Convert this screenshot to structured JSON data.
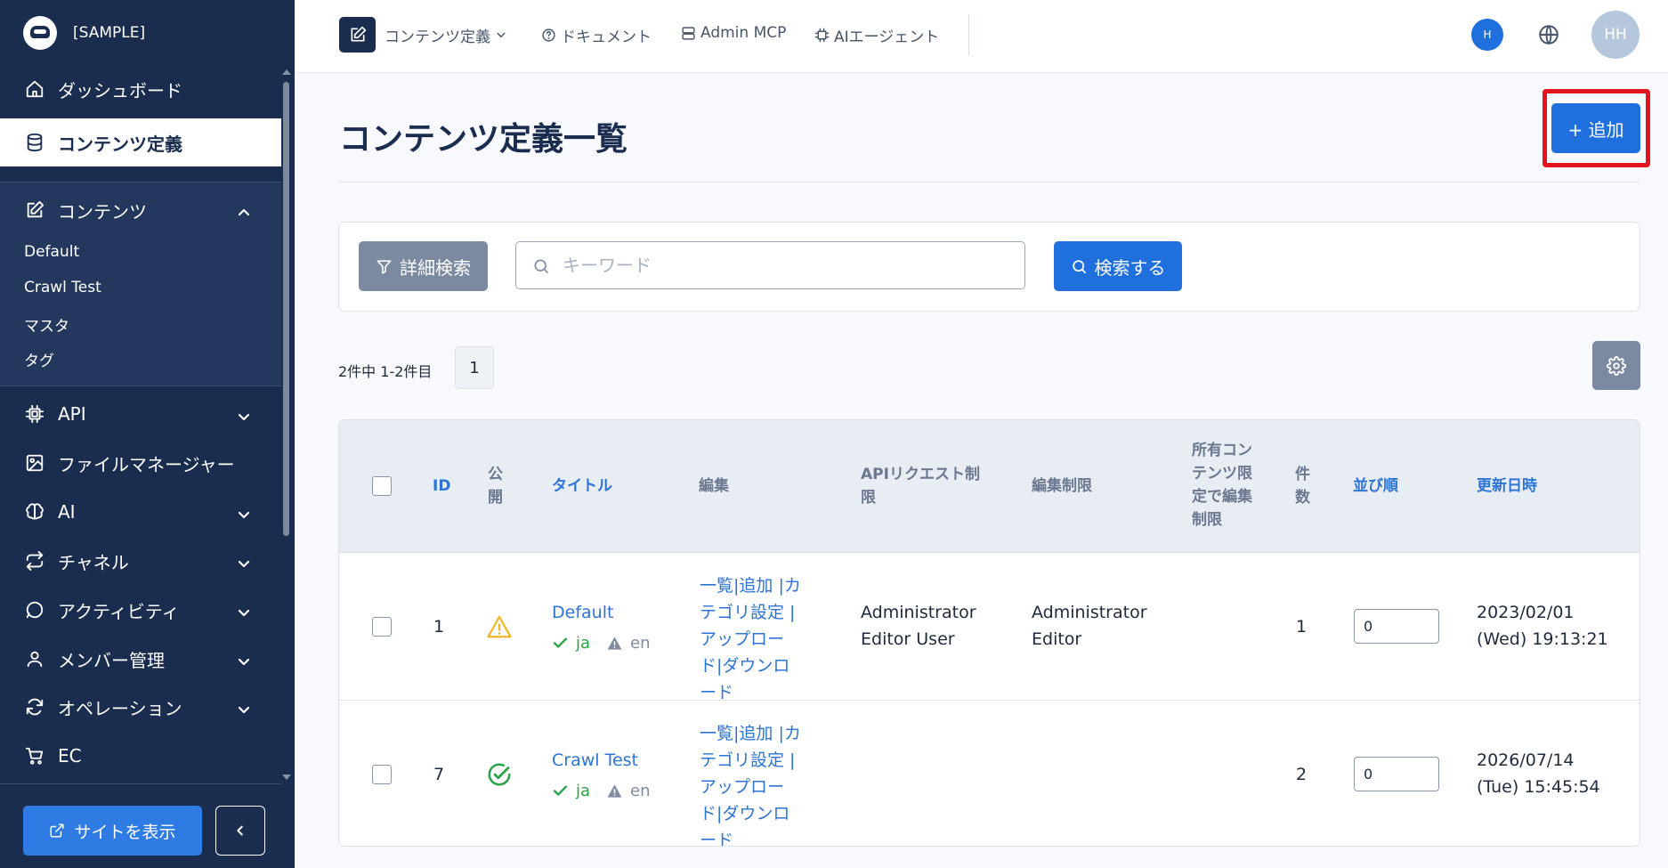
{
  "sidebar": {
    "brand_name": "[SAMPLE]",
    "items": [
      {
        "label": "ダッシュボード",
        "icon": "home-icon"
      },
      {
        "label": "コンテンツ定義",
        "icon": "database-icon"
      },
      {
        "label": "コンテンツ",
        "icon": "edit-icon"
      },
      {
        "label": "API",
        "icon": "chip-icon"
      },
      {
        "label": "ファイルマネージャー",
        "icon": "image-icon"
      },
      {
        "label": "AI",
        "icon": "brain-icon"
      },
      {
        "label": "チャネル",
        "icon": "repeat-icon"
      },
      {
        "label": "アクティビティ",
        "icon": "message-icon"
      },
      {
        "label": "メンバー管理",
        "icon": "user-icon"
      },
      {
        "label": "オペレーション",
        "icon": "refresh-icon"
      },
      {
        "label": "EC",
        "icon": "cart-icon"
      }
    ],
    "sub_items": [
      "Default",
      "Crawl Test",
      "マスタ",
      "タグ"
    ],
    "site_button": "サイトを表示"
  },
  "topbar": {
    "links": [
      "コンテンツ定義",
      "ドキュメント",
      "Admin MCP",
      "AIエージェント"
    ],
    "user_initial": "H",
    "avatar_initials": "HH"
  },
  "main": {
    "title": "コンテンツ定義一覧",
    "add_button": "+ 追加",
    "advanced_search": "詳細検索",
    "keyword_placeholder": "キーワード",
    "search_button": "検索する",
    "count_text": "2件中 1-2件目",
    "current_page": "1"
  },
  "table": {
    "headers": {
      "id": "ID",
      "public": "公開",
      "title": "タイトル",
      "edit": "編集",
      "api_limit": "APIリクエスト制限",
      "edit_limit": "編集制限",
      "owner_limit": "所有コンテンツ限定で編集制限",
      "count": "件数",
      "order": "並び順",
      "updated": "更新日時"
    },
    "rows": [
      {
        "id": "1",
        "status": "warning",
        "title": "Default",
        "lang_ja": "ja",
        "lang_en": "en",
        "edit_links": "一覧|追加 |カテゴリ設定 |アップロード|ダウンロード",
        "api_limit": "Administrator Editor User",
        "edit_limit": "Administrator Editor",
        "count": "1",
        "order": "0",
        "updated": "2023/02/01 (Wed) 19:13:21"
      },
      {
        "id": "7",
        "status": "published",
        "title": "Crawl Test",
        "lang_ja": "ja",
        "lang_en": "en",
        "edit_links": "一覧|追加 |カテゴリ設定 |アップロード|ダウンロード",
        "api_limit": "",
        "edit_limit": "",
        "count": "2",
        "order": "0",
        "updated": "2026/07/14 (Tue) 15:45:54"
      }
    ]
  },
  "colors": {
    "sidebar_bg": "#1b2d4f",
    "primary": "#1f6fdc",
    "highlight_border": "#e3141c",
    "success": "#2aa24a",
    "warning": "#f0b429"
  }
}
